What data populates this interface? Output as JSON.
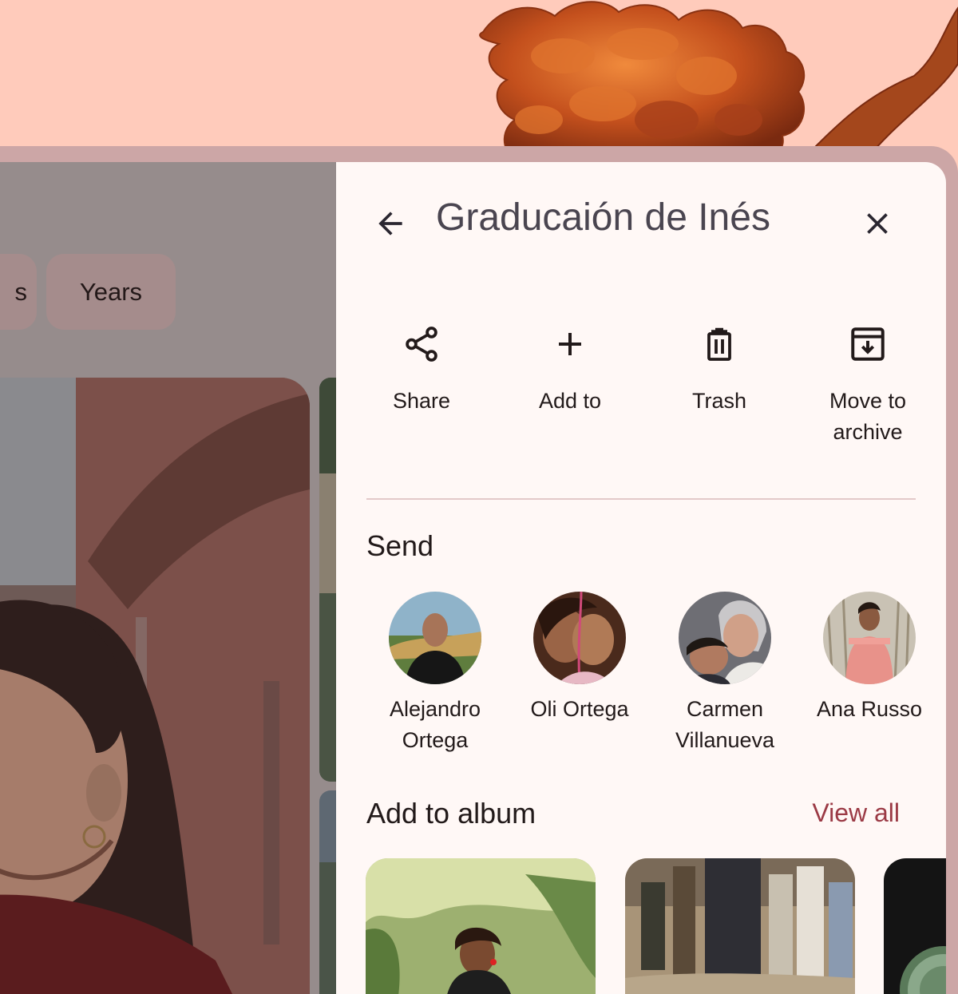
{
  "background": {
    "page_color": "#ffcbbb",
    "frame_color": "#cca6a6",
    "decoration_icon": "seaweed-illustration"
  },
  "left_app": {
    "chips": [
      {
        "label": "s"
      },
      {
        "label": "Years"
      }
    ]
  },
  "sheet": {
    "title": "Graducaión de Inés",
    "back_icon": "arrow-back-icon",
    "close_icon": "close-icon",
    "actions": [
      {
        "label": "Share",
        "icon": "share-icon"
      },
      {
        "label": "Add to",
        "icon": "plus-icon"
      },
      {
        "label": "Trash",
        "icon": "trash-icon"
      },
      {
        "label": "Move to archive",
        "icon": "archive-icon"
      }
    ],
    "send": {
      "title": "Send",
      "contacts": [
        {
          "name": "Alejandro Ortega"
        },
        {
          "name": "Oli Ortega"
        },
        {
          "name": "Carmen Villanueva"
        },
        {
          "name": "Ana Russo"
        }
      ]
    },
    "album": {
      "title": "Add to album",
      "view_all": "View all",
      "accent": "#9b3a45"
    }
  }
}
